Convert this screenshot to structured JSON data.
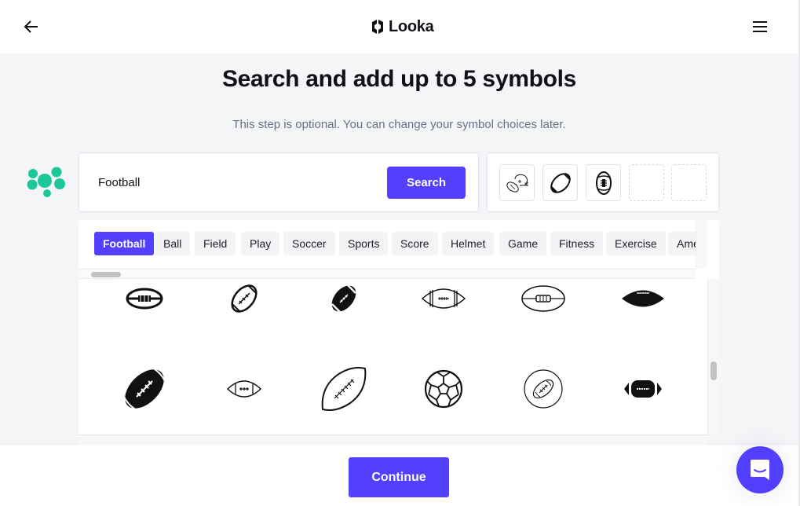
{
  "header": {
    "back_icon": "arrow-left-icon",
    "logo_icon": "looka-logo-icon",
    "logo_text": "Looka",
    "menu_icon": "hamburger-menu-icon"
  },
  "main": {
    "title": "Search and add up to 5 symbols",
    "subtitle": "This step is optional. You can change your symbol choices later.",
    "mascot_icon": "green-dots-mascot-icon"
  },
  "search": {
    "value": "Football",
    "placeholder": "",
    "button_label": "Search"
  },
  "selected_symbols": {
    "max": 5,
    "slots": [
      {
        "icon": "helmet-and-football-icon",
        "filled": true
      },
      {
        "icon": "striped-football-icon",
        "filled": true
      },
      {
        "icon": "upright-football-icon",
        "filled": true
      },
      {
        "icon": "",
        "filled": false
      },
      {
        "icon": "",
        "filled": false
      }
    ]
  },
  "suggestion_chips": [
    {
      "label": "Football",
      "active": true
    },
    {
      "label": "Ball",
      "active": false
    },
    {
      "label": "Field",
      "active": false
    },
    {
      "label": "Play",
      "active": false
    },
    {
      "label": "Soccer",
      "active": false
    },
    {
      "label": "Sports",
      "active": false
    },
    {
      "label": "Score",
      "active": false
    },
    {
      "label": "Helmet",
      "active": false
    },
    {
      "label": "Game",
      "active": false
    },
    {
      "label": "Fitness",
      "active": false
    },
    {
      "label": "Exercise",
      "active": false
    },
    {
      "label": "American",
      "active": false
    }
  ],
  "results": {
    "rows": [
      [
        {
          "icon": "football-outline-laces-icon"
        },
        {
          "icon": "football-tilted-outline-icon"
        },
        {
          "icon": "football-tilted-solid-icon"
        },
        {
          "icon": "football-striped-outline-icon"
        },
        {
          "icon": "football-center-band-icon"
        },
        {
          "icon": "football-solid-flat-icon"
        }
      ],
      [
        {
          "icon": "football-solid-large-icon"
        },
        {
          "icon": "football-small-outline-icon"
        },
        {
          "icon": "football-thin-outline-icon"
        },
        {
          "icon": "soccer-ball-icon"
        },
        {
          "icon": "football-in-circle-icon"
        },
        {
          "icon": "football-solid-side-icon"
        }
      ]
    ]
  },
  "footer": {
    "continue_label": "Continue",
    "chat_icon": "chat-support-icon"
  },
  "colors": {
    "accent": "#5340ff",
    "mascot": "#1cc899",
    "background": "#f4f5f7"
  }
}
